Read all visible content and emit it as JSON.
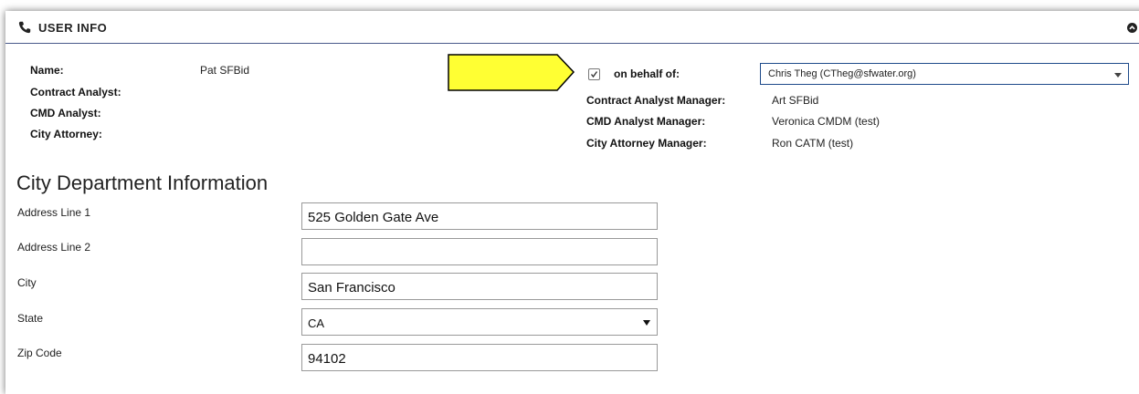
{
  "header": {
    "title": "USER INFO",
    "icon": "phone-icon",
    "collapse_icon": "chevron-up-circle-icon"
  },
  "user_info": {
    "name_label": "Name:",
    "name_value": "Pat SFBid",
    "contract_analyst_label": "Contract Analyst:",
    "cmd_analyst_label": "CMD Analyst:",
    "city_attorney_label": "City Attorney:"
  },
  "annotation": {
    "arrow_color": "#ffff33"
  },
  "behalf": {
    "checked": true,
    "label": "on behalf of:",
    "selected": "Chris Theg (CTheg@sfwater.org)",
    "contract_analyst_manager_label": "Contract Analyst Manager:",
    "contract_analyst_manager_value": "Art SFBid",
    "cmd_analyst_manager_label": "CMD Analyst Manager:",
    "cmd_analyst_manager_value": "Veronica CMDM (test)",
    "city_attorney_manager_label": "City Attorney Manager:",
    "city_attorney_manager_value": "Ron CATM (test)"
  },
  "department": {
    "title": "City Department Information",
    "address1_label": "Address Line 1",
    "address1_value": "525 Golden Gate Ave",
    "address2_label": "Address Line 2",
    "address2_value": "",
    "city_label": "City",
    "city_value": "San Francisco",
    "state_label": "State",
    "state_value": "CA",
    "zip_label": "Zip Code",
    "zip_value": "94102"
  }
}
